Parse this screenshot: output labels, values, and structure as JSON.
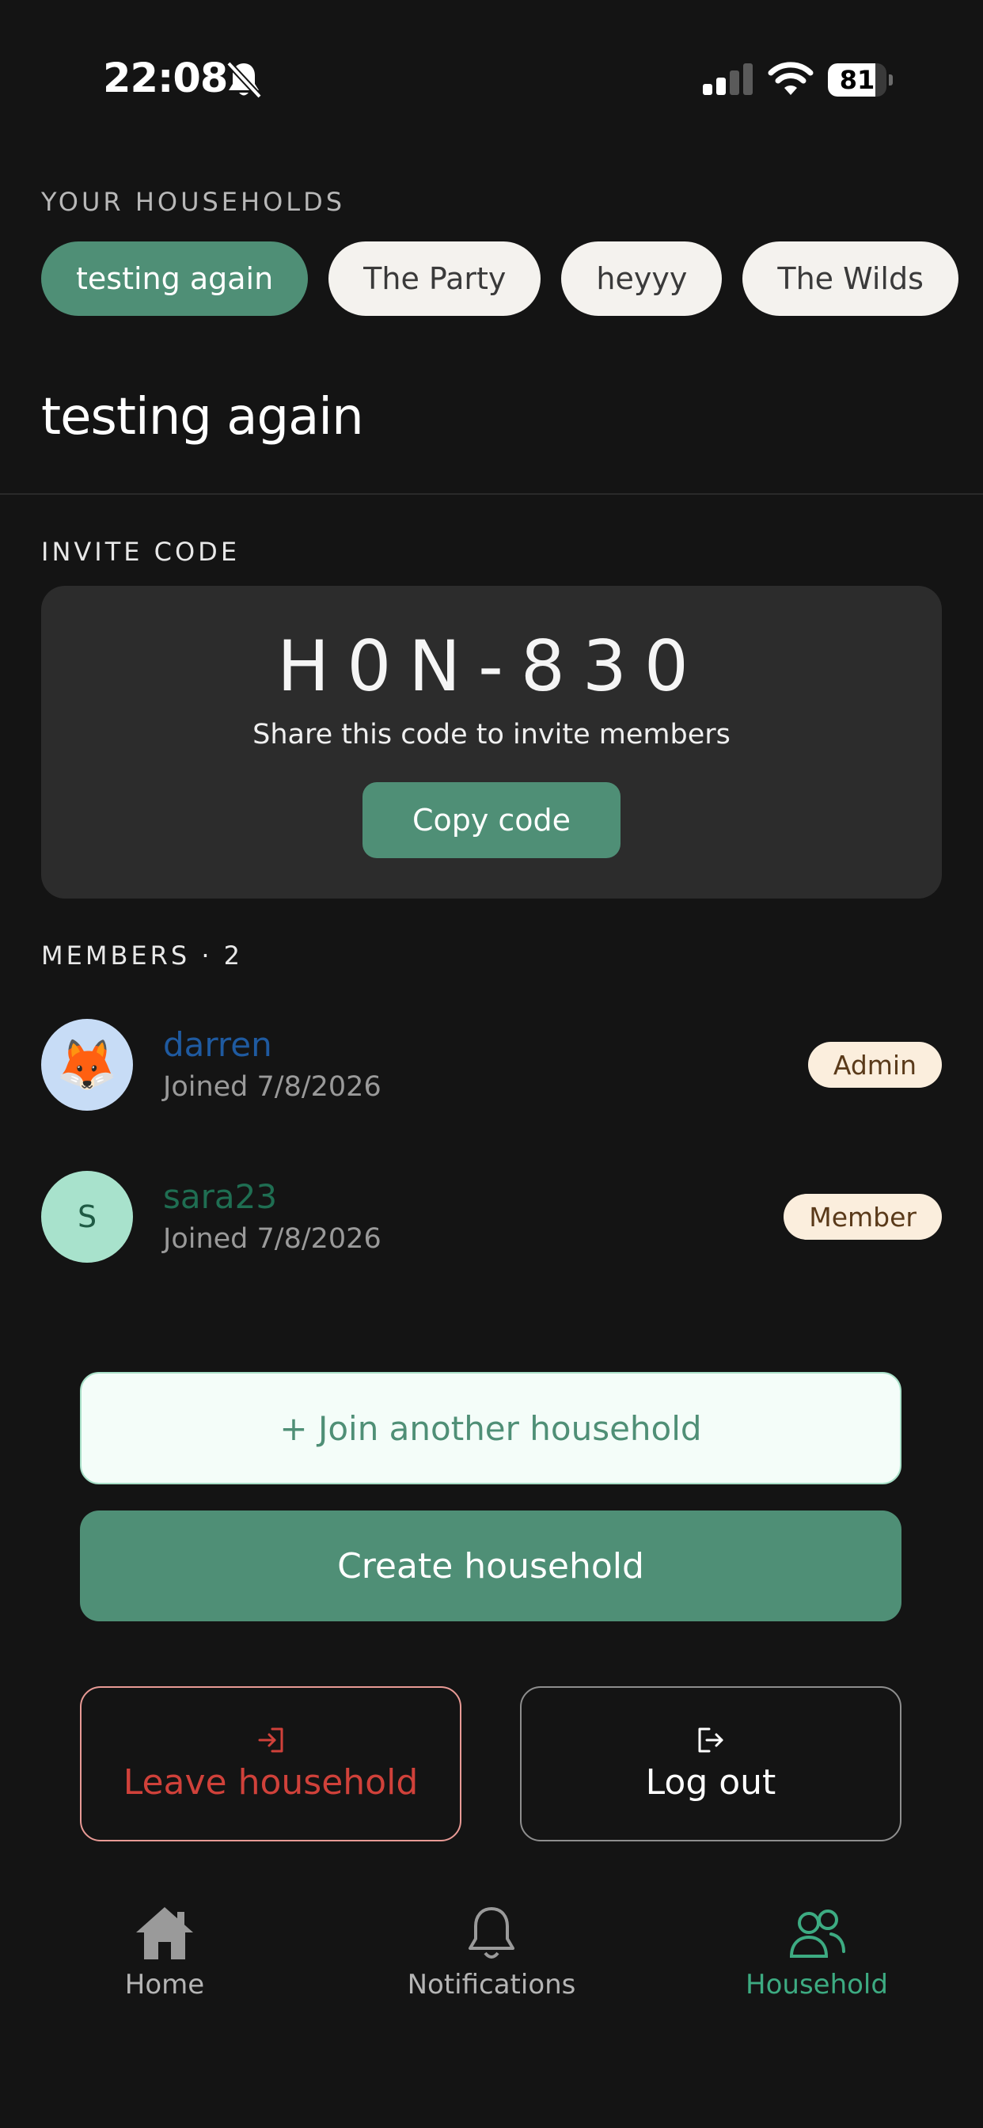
{
  "status_bar": {
    "time": "22:08",
    "battery": "81",
    "battery_level": 0.81
  },
  "households": {
    "section_label": "YOUR HOUSEHOLDS",
    "items": [
      {
        "label": "testing again",
        "active": true
      },
      {
        "label": "The Party",
        "active": false
      },
      {
        "label": "heyyy",
        "active": false
      },
      {
        "label": "The Wilds",
        "active": false
      }
    ],
    "current_title": "testing again"
  },
  "invite": {
    "section_label": "INVITE CODE",
    "code": "H0N-830",
    "subtitle": "Share this code to invite members",
    "copy_label": "Copy code"
  },
  "members": {
    "section_label": "MEMBERS · 2",
    "items": [
      {
        "name": "darren",
        "joined": "Joined 7/8/2026",
        "role": "Admin",
        "avatar": "🦊",
        "name_color": "#1f5aa0",
        "avatar_bg": "#c7dcf6"
      },
      {
        "name": "sara23",
        "joined": "Joined 7/8/2026",
        "role": "Member",
        "avatar": "S",
        "name_color": "#1f6e52",
        "avatar_bg": "#a8e2cc"
      }
    ]
  },
  "actions": {
    "join_label": "+ Join another household",
    "create_label": "Create household",
    "leave_label": "Leave household",
    "logout_label": "Log out"
  },
  "nav": {
    "items": [
      {
        "label": "Home",
        "icon": "home-icon",
        "active": false
      },
      {
        "label": "Notifications",
        "icon": "bell-icon",
        "active": false
      },
      {
        "label": "Household",
        "icon": "users-icon",
        "active": true
      }
    ]
  },
  "colors": {
    "background": "#141414",
    "accent": "#4f8f76",
    "nav_active": "#3dab82",
    "danger": "#c0392b"
  }
}
